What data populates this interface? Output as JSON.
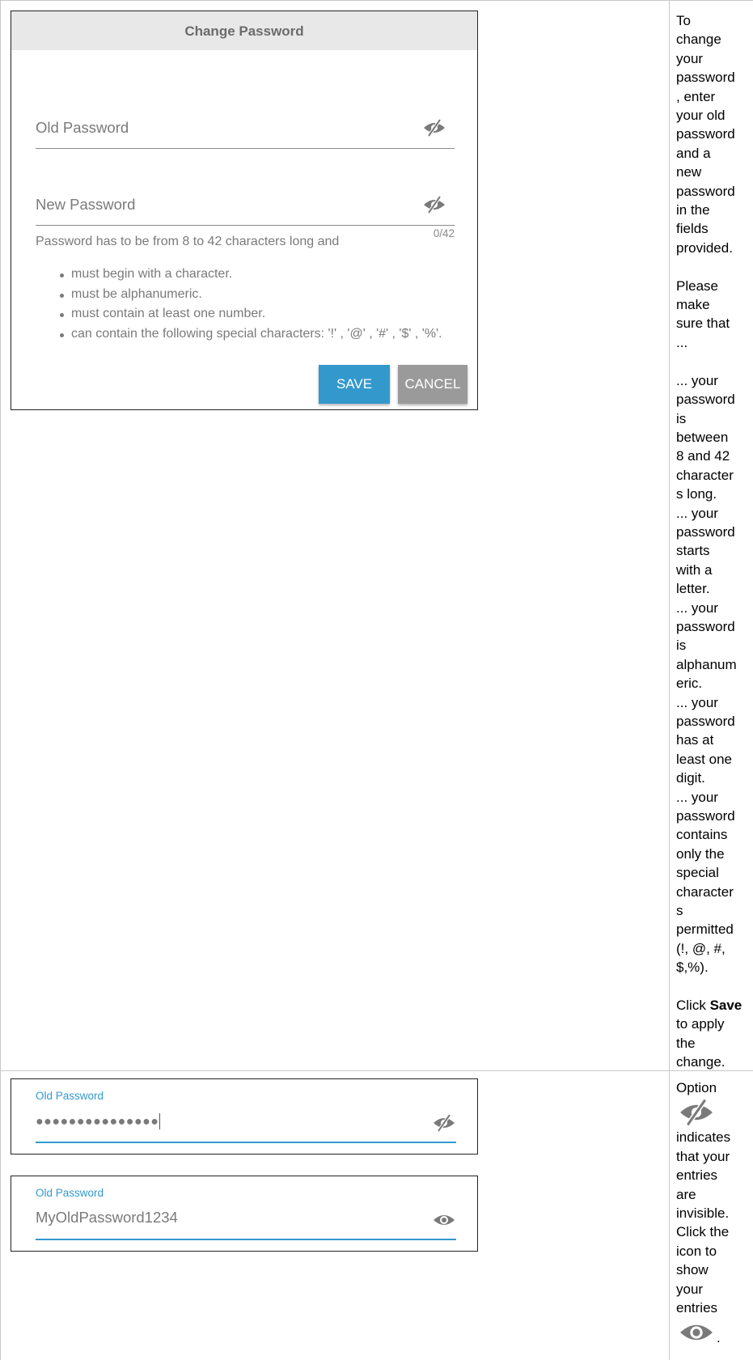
{
  "dialog": {
    "title": "Change Password",
    "old_password_label": "Old Password",
    "new_password_label": "New Password",
    "counter": "0/42",
    "rules_intro": "Password has to be from 8 to 42 characters long and",
    "rules": [
      "must begin with a character.",
      "must be alphanumeric.",
      "must contain at least one number.",
      "can contain the following special characters: '!' , '@' , '#' , '$' , '%'."
    ],
    "save_label": "SAVE",
    "cancel_label": "CANCEL"
  },
  "field_hidden": {
    "label": "Old Password",
    "value_masked": "●●●●●●●●●●●●●●●",
    "icon": "eye-slash-icon"
  },
  "field_visible": {
    "label": "Old Password",
    "value": "MyOldPassword1234",
    "icon": "eye-icon"
  },
  "side_text_1": {
    "intro": "To\nchange\nyour\npassword\n, enter\nyour old\npassword\nand a\nnew\npassword\nin the\nfields\nprovided.",
    "please": "Please\nmake\nsure that\n...",
    "checks": "... your\npassword\nis\nbetween\n8 and 42\ncharacter\ns long.\n... your\npassword\nstarts\nwith a\nletter.\n... your\npassword\nis\nalphanum\neric.\n... your\npassword\nhas at\nleast one\ndigit.\n... your\npassword\ncontains\nonly the\nspecial\ncharacter\ns\npermitted\n(!, @, #,\n$,%).",
    "click_prefix": "Click ",
    "click_bold": "Save",
    "click_suffix": "\nto apply\nthe\nchange."
  },
  "side_text_2": {
    "option": "Option",
    "middle": "indicates\nthat your\nentries\nare\ninvisible.\nClick the\nicon to\nshow\nyour\nentries",
    "end": "."
  },
  "colors": {
    "accent": "#3399cc",
    "cancel": "#9a9a9a",
    "header_bg": "#e8e8e8",
    "muted_text": "#7a7a7a"
  }
}
